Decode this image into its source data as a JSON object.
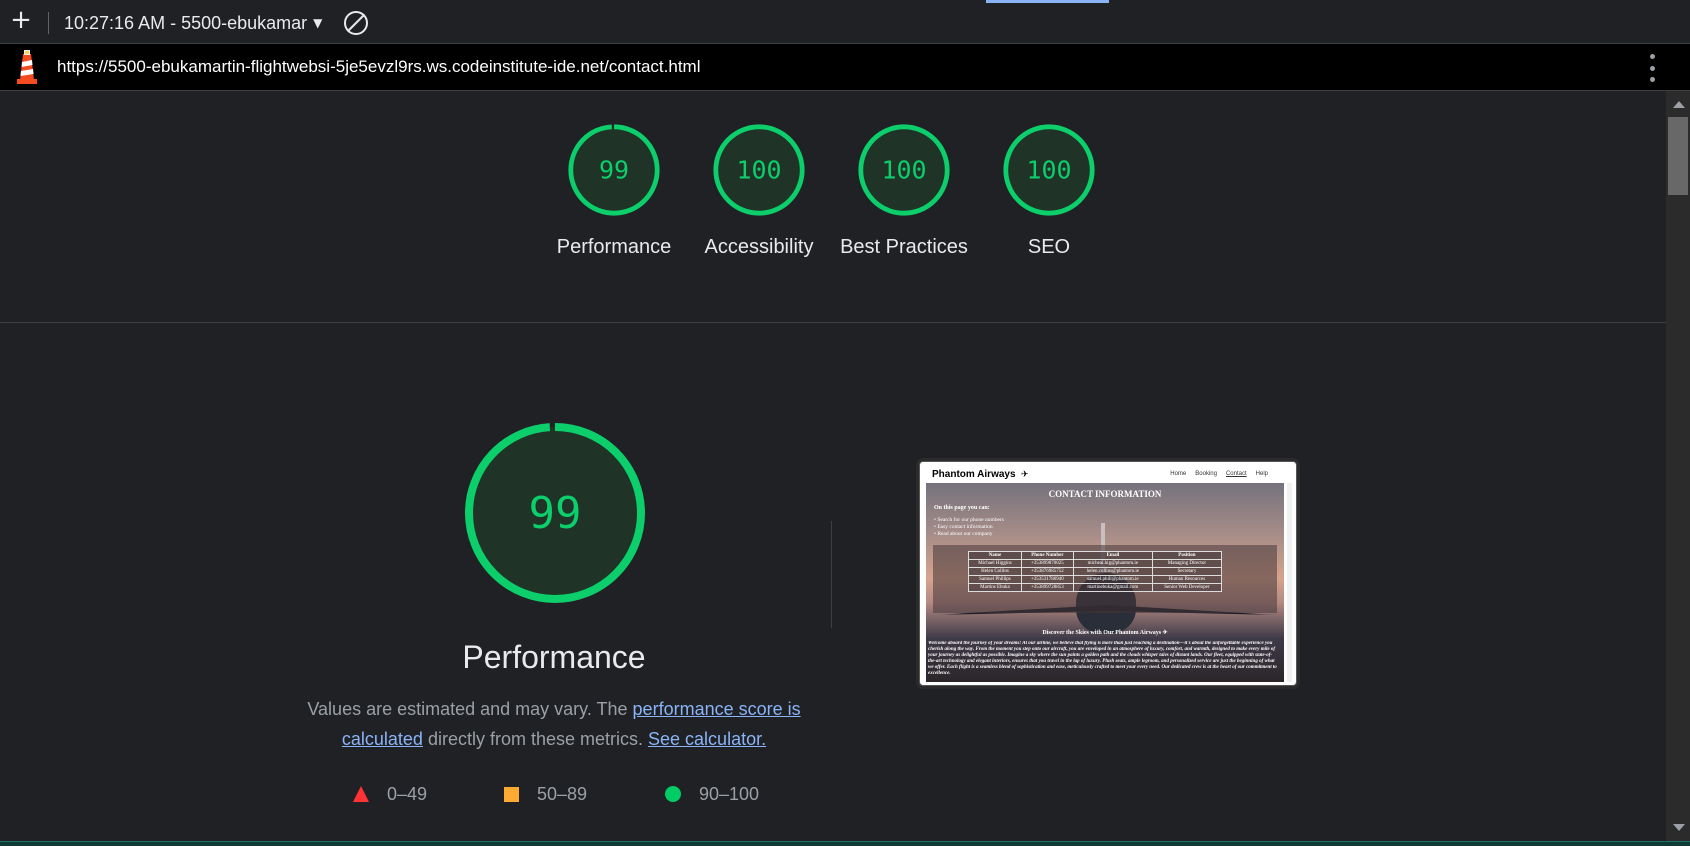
{
  "toolbar": {
    "new_tab_icon": "plus-icon",
    "session_label": "10:27:16 AM - 5500-ebukamar",
    "caret_icon": "dropdown-caret-icon",
    "clear_icon": "block-icon"
  },
  "urlbar": {
    "url": "https://5500-ebukamartin-flightwebsi-5je5evzl9rs.ws.codeinstitute-ide.net/contact.html",
    "menu_icon": "kebab-menu-icon"
  },
  "scores": [
    {
      "label": "Performance",
      "value": "99",
      "score": 99
    },
    {
      "label": "Accessibility",
      "value": "100",
      "score": 100
    },
    {
      "label": "Best Practices",
      "value": "100",
      "score": 100
    },
    {
      "label": "SEO",
      "value": "100",
      "score": 100
    }
  ],
  "performance": {
    "score": "99",
    "title": "Performance",
    "desc_prefix": "Values are estimated and may vary. The ",
    "desc_link1": "performance score is calculated",
    "desc_middle": " directly from these metrics. ",
    "desc_link2": "See calculator."
  },
  "legend": [
    {
      "range": "0–49",
      "color": "#ff3333"
    },
    {
      "range": "50–89",
      "color": "#ffaa33"
    },
    {
      "range": "90–100",
      "color": "#00cc66"
    }
  ],
  "thumbnail": {
    "brand": "Phantom Airways",
    "nav": [
      "Home",
      "Booking",
      "Contact",
      "Help"
    ],
    "heading": "CONTACT INFORMATION",
    "subheading": "On this page you can:",
    "bullets": [
      "Search for our phone numbers",
      "Easy contact information",
      "Read about our company"
    ],
    "table_headers": [
      "Name",
      "Phone Number",
      "Email",
      "Position"
    ],
    "table_rows": [
      [
        "Michael Higgins",
        "+353899870025",
        "micheal.hig@phantom.ie",
        "Managing Director"
      ],
      [
        "Helen Collins",
        "+353876985752",
        "helen.collins@phantom.ie",
        "Secretary"
      ],
      [
        "Samuel Phillips",
        "+353531786940",
        "samuel.phill@phantom.ie",
        "Human Resources"
      ],
      [
        "Martins Ebuka",
        "+353899728853",
        "martinebuka@gmail.com",
        "Senior Web Developer"
      ]
    ],
    "discover": "Discover the Skies with Our Phantom Airways",
    "paragraph": "Welcome aboard the journey of your dreams! At our airline, we believe that flying is more than just reaching a destination—it's about the unforgettable experience you cherish along the way. From the moment you step onto our aircraft, you are enveloped in an atmosphere of luxury, comfort, and warmth, designed to make every mile of your journey as delightful as possible. Imagine a sky where the sun paints a golden path and the clouds whisper tales of distant lands. Our fleet, equipped with state-of-the-art technology and elegant interiors, ensures that you travel in the lap of luxury. Plush seats, ample legroom, and personalized service are just the beginning of what we offer. Each flight is a seamless blend of sophistication and ease, meticulously crafted to meet your every need. Our dedicated crew is at the heart of our commitment to excellence."
  },
  "colors": {
    "pass": "#0cce6b",
    "gauge_fill": "#1f3327",
    "background": "#202124",
    "link": "#8ab4f8"
  }
}
